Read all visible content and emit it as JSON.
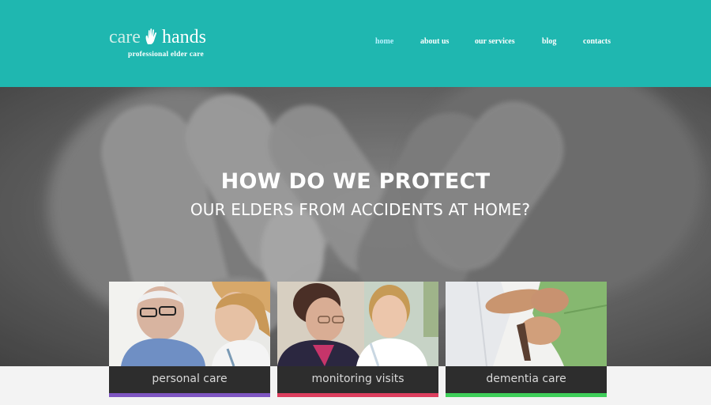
{
  "brand": {
    "name_part1": "care",
    "name_part2": "hands",
    "tagline": "professional elder care",
    "logo_icon": "hand-icon"
  },
  "nav": {
    "items": [
      {
        "label": "home",
        "active": true
      },
      {
        "label": "about us",
        "active": false
      },
      {
        "label": "our services",
        "active": false
      },
      {
        "label": "blog",
        "active": false
      },
      {
        "label": "contacts",
        "active": false
      }
    ]
  },
  "hero": {
    "title": "HOW DO WE PROTECT",
    "subtitle": "OUR ELDERS FROM ACCIDENTS AT HOME?"
  },
  "services": [
    {
      "label": "personal care",
      "accent": "#7f56c2"
    },
    {
      "label": "monitoring visits",
      "accent": "#dd3f5f"
    },
    {
      "label": "dementia care",
      "accent": "#3fcf5a"
    }
  ],
  "colors": {
    "header_bg": "#1fb7b0",
    "nav_active": "#b9f1ff",
    "card_label_bg": "#2d2d2d"
  }
}
